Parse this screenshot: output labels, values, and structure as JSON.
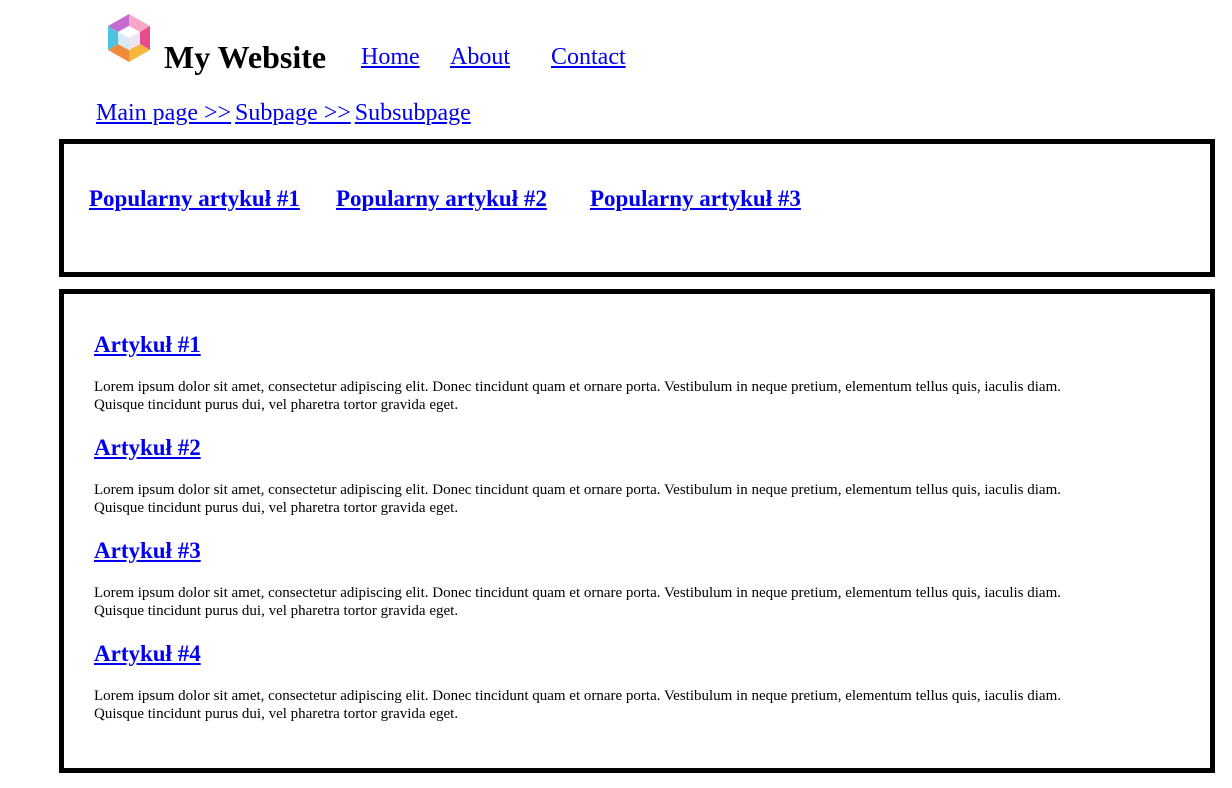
{
  "site": {
    "title": "My Website",
    "logo_icon": "colorful-hexagon-cube-logo"
  },
  "nav": {
    "items": [
      {
        "label": "Home"
      },
      {
        "label": "About"
      },
      {
        "label": "Contact"
      }
    ]
  },
  "breadcrumb": {
    "items": [
      {
        "label": "Main page >>"
      },
      {
        "label": "Subpage >>"
      },
      {
        "label": "Subsubpage"
      }
    ]
  },
  "popular": {
    "items": [
      {
        "label": "Popularny artykuł #1"
      },
      {
        "label": "Popularny artykuł #2"
      },
      {
        "label": "Popularny artykuł #3"
      }
    ]
  },
  "articles": [
    {
      "title": "Artykuł #1",
      "text": "Lorem ipsum dolor sit amet, consectetur adipiscing elit. Donec tincidunt quam et ornare porta. Vestibulum in neque pretium, elementum tellus quis, iaculis diam. Quisque tincidunt purus dui, vel pharetra tortor gravida eget."
    },
    {
      "title": "Artykuł #2",
      "text": "Lorem ipsum dolor sit amet, consectetur adipiscing elit. Donec tincidunt quam et ornare porta. Vestibulum in neque pretium, elementum tellus quis, iaculis diam. Quisque tincidunt purus dui, vel pharetra tortor gravida eget."
    },
    {
      "title": "Artykuł #3",
      "text": "Lorem ipsum dolor sit amet, consectetur adipiscing elit. Donec tincidunt quam et ornare porta. Vestibulum in neque pretium, elementum tellus quis, iaculis diam. Quisque tincidunt purus dui, vel pharetra tortor gravida eget."
    },
    {
      "title": "Artykuł #4",
      "text": "Lorem ipsum dolor sit amet, consectetur adipiscing elit. Donec tincidunt quam et ornare porta. Vestibulum in neque pretium, elementum tellus quis, iaculis diam. Quisque tincidunt purus dui, vel pharetra tortor gravida eget."
    }
  ],
  "colors": {
    "link": "#0000ee",
    "border": "#000000",
    "background": "#ffffff"
  }
}
